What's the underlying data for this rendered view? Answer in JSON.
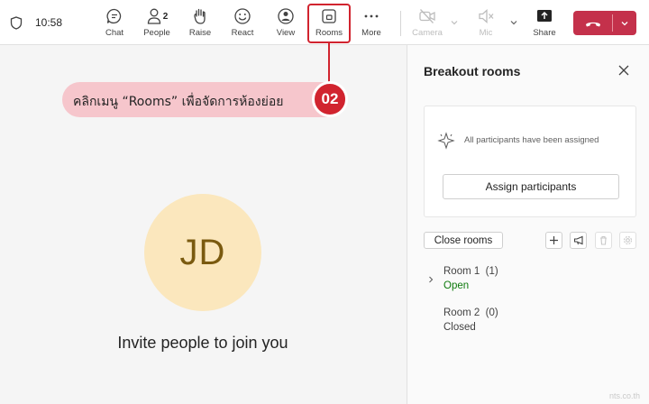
{
  "header": {
    "time": "10:58",
    "toolbar": {
      "chat": "Chat",
      "people": "People",
      "people_count": "2",
      "raise": "Raise",
      "react": "React",
      "view": "View",
      "rooms": "Rooms",
      "more": "More",
      "camera": "Camera",
      "mic": "Mic",
      "share": "Share"
    }
  },
  "callout": {
    "text": "คลิกเมนู “Rooms” เพื่อจัดการห้องย่อย",
    "step": "02"
  },
  "stage": {
    "avatar_initials": "JD",
    "invite_text": "Invite people to join you"
  },
  "breakout_panel": {
    "title": "Breakout rooms",
    "status_text": "All participants have been assigned",
    "assign_button": "Assign participants",
    "close_rooms_button": "Close rooms",
    "rooms": [
      {
        "name": "Room 1",
        "count": "(1)",
        "status": "Open"
      },
      {
        "name": "Room 2",
        "count": "(0)",
        "status": "Closed"
      }
    ]
  },
  "watermark": "nts.co.th",
  "colors": {
    "accent_red": "#d1242f",
    "leave_red": "#c4314b",
    "callout_bg": "#f6c6cc",
    "avatar_bg": "#fbe7bd",
    "open_green": "#0e7a0d"
  }
}
